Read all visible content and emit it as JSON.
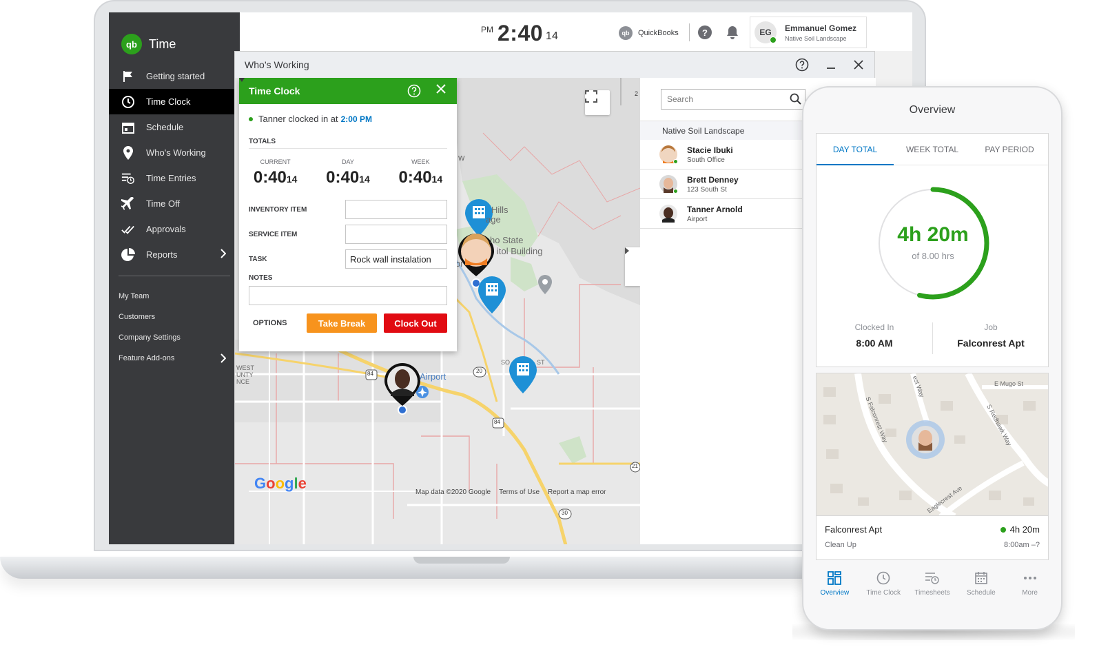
{
  "app": {
    "logo_text": "qb",
    "name": "Time"
  },
  "sidebar": {
    "items": [
      {
        "label": "Getting started"
      },
      {
        "label": "Time Clock"
      },
      {
        "label": "Schedule"
      },
      {
        "label": "Who's Working"
      },
      {
        "label": "Time Entries"
      },
      {
        "label": "Time Off"
      },
      {
        "label": "Approvals"
      },
      {
        "label": "Reports"
      }
    ],
    "sub_items": [
      {
        "label": "My Team"
      },
      {
        "label": "Customers"
      },
      {
        "label": "Company Settings"
      },
      {
        "label": "Feature Add-ons"
      }
    ]
  },
  "topbar": {
    "clock_ampm": "PM",
    "clock_time": "2:40",
    "clock_seconds": "14",
    "qb_logo_text": "qb",
    "qb_label": "QuickBooks",
    "help_label": "?",
    "user_initials": "EG",
    "user_name": "Emmanuel Gomez",
    "user_company": "Native Soil Landscape"
  },
  "window": {
    "title": "Who’s Working"
  },
  "map": {
    "labels": {
      "hills": "Hills",
      "age": "age",
      "capitol1": "ho State",
      "capitol2": "itol Building",
      "airport": "Airport",
      "west1": "WEST",
      "west2": "UNTY",
      "west3": "NCE",
      "so": "SO",
      "st": "ST",
      "w": "w",
      "or": "or",
      "hw84a": "84",
      "hw84b": "84",
      "hw20": "20",
      "hw21": "21",
      "hw30": "30",
      "hw2": "2"
    },
    "google": [
      "G",
      "o",
      "o",
      "g",
      "l",
      "e"
    ],
    "footer": {
      "data": "Map data ©2020 Google",
      "terms": "Terms of Use",
      "report": "Report a map error"
    }
  },
  "time_clock": {
    "title": "Time Clock",
    "status_text": "Tanner clocked in at",
    "status_time": "2:00 PM",
    "totals_label": "TOTALS",
    "totals": [
      {
        "label": "CURRENT",
        "main": "0:40",
        "sec": "14"
      },
      {
        "label": "DAY",
        "main": "0:40",
        "sec": "14"
      },
      {
        "label": "WEEK",
        "main": "0:40",
        "sec": "14"
      }
    ],
    "fields": {
      "inventory_label": "INVENTORY ITEM",
      "inventory_value": "",
      "service_label": "SERVICE ITEM",
      "service_value": "",
      "task_label": "TASK",
      "task_value": "Rock wall instalation",
      "notes_label": "NOTES",
      "notes_value": ""
    },
    "options_label": "OPTIONS",
    "break_label": "Take Break",
    "clockout_label": "Clock Out"
  },
  "employees": {
    "search_placeholder": "Search",
    "group": "Native Soil Landscape",
    "list": [
      {
        "name": "Stacie Ibuki",
        "location": "South Office"
      },
      {
        "name": "Brett Denney",
        "location": "123 South St"
      },
      {
        "name": "Tanner Arnold",
        "location": "Airport"
      }
    ]
  },
  "phone": {
    "title": "Overview",
    "tabs": [
      {
        "label": "DAY TOTAL"
      },
      {
        "label": "WEEK TOTAL"
      },
      {
        "label": "PAY PERIOD"
      }
    ],
    "progress_fraction": 0.54,
    "progress_main": "4h 20m",
    "progress_sub": "of 8.00 hrs",
    "clocked_in_label": "Clocked In",
    "clocked_in_value": "8:00 AM",
    "job_label": "Job",
    "job_value": "Falconrest Apt",
    "map_labels": {
      "mugo": "E Mugo St",
      "east_way": "est Way",
      "falconrest": "S Falconrest Way",
      "redhawk": "S Redhawk Way",
      "eaglecrest": "Eaglecrest Ave"
    },
    "job_card": {
      "name": "Falconrest Apt",
      "task": "Clean Up",
      "duration": "4h 20m",
      "range": "8:00am –?"
    },
    "nav": [
      {
        "label": "Overview"
      },
      {
        "label": "Time Clock"
      },
      {
        "label": "Timesheets"
      },
      {
        "label": "Schedule"
      },
      {
        "label": "More"
      }
    ]
  },
  "colors": {
    "brand_green": "#2ca01c",
    "accent_blue": "#0077c5",
    "sidebar": "#393a3d",
    "break_orange": "#f7931d",
    "clockout_red": "#e10b12"
  }
}
